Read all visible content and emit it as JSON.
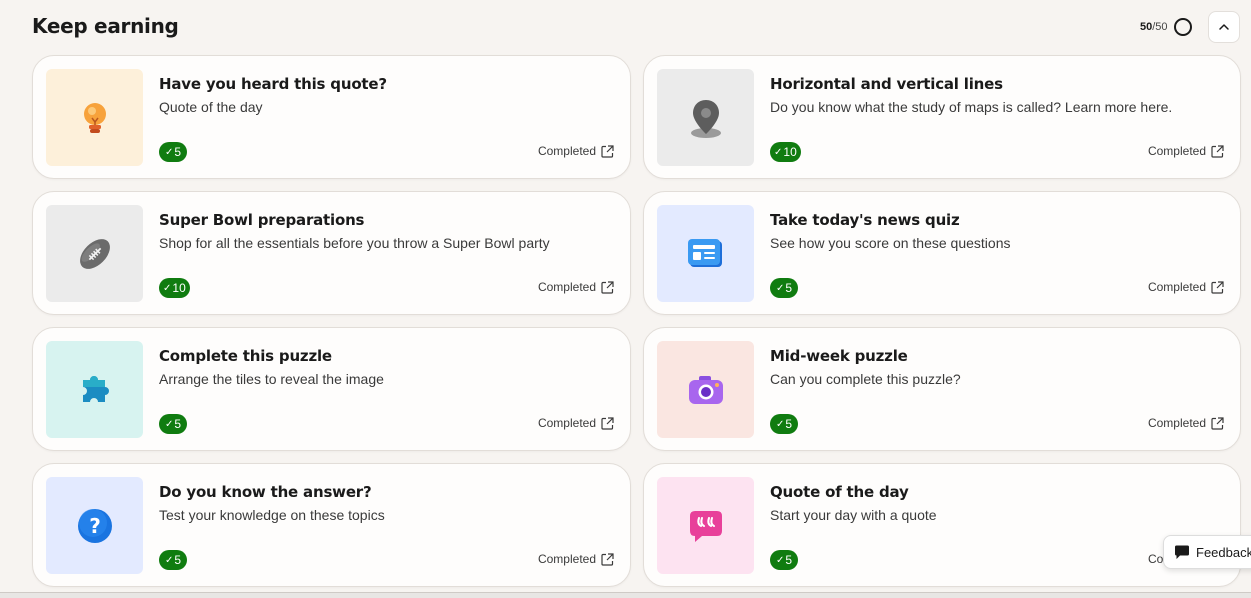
{
  "section": {
    "title": "Keep earning",
    "progress_earned": "50",
    "progress_total": "/50"
  },
  "cards": [
    {
      "title": "Have you heard this quote?",
      "subtitle": "Quote of the day",
      "points": "5",
      "status": "Completed",
      "icon": "lightbulb-icon",
      "bg": "#fdf0da"
    },
    {
      "title": "Horizontal and vertical lines",
      "subtitle": "Do you know what the study of maps is called? Learn more here.",
      "points": "10",
      "status": "Completed",
      "icon": "map-pin-icon",
      "bg": "#ebebeb"
    },
    {
      "title": "Super Bowl preparations",
      "subtitle": "Shop for all the essentials before you throw a Super Bowl party",
      "points": "10",
      "status": "Completed",
      "icon": "football-icon",
      "bg": "#ebebeb"
    },
    {
      "title": "Take today's news quiz",
      "subtitle": "See how you score on these questions",
      "points": "5",
      "status": "Completed",
      "icon": "newspaper-icon",
      "bg": "#e3eaff"
    },
    {
      "title": "Complete this puzzle",
      "subtitle": "Arrange the tiles to reveal the image",
      "points": "5",
      "status": "Completed",
      "icon": "puzzle-piece-icon",
      "bg": "#d7f3f0"
    },
    {
      "title": "Mid-week puzzle",
      "subtitle": "Can you complete this puzzle?",
      "points": "5",
      "status": "Completed",
      "icon": "camera-icon",
      "bg": "#fae6e1"
    },
    {
      "title": "Do you know the answer?",
      "subtitle": "Test your knowledge on these topics",
      "points": "5",
      "status": "Completed",
      "icon": "question-icon",
      "bg": "#e3eaff"
    },
    {
      "title": "Quote of the day",
      "subtitle": "Start your day with a quote",
      "points": "5",
      "status": "Completed",
      "icon": "quote-bubble-icon",
      "bg": "#fde3f1"
    }
  ],
  "feedback": {
    "label": "Feedback"
  },
  "colors": {
    "badge": "#107c10",
    "page_bg": "#f7f4f1"
  }
}
